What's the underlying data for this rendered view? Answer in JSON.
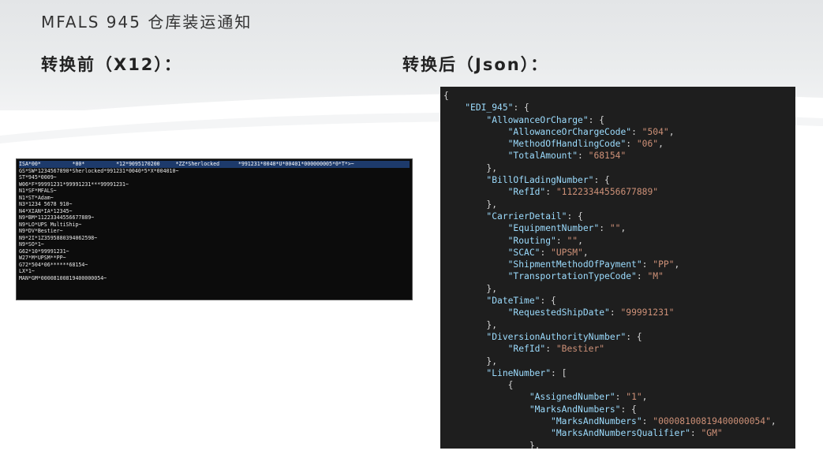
{
  "slide": {
    "title": "MFALS 945 仓库装运通知",
    "before_label": "转换前（X12）：",
    "after_label": "转换后（Json）："
  },
  "colors": {
    "x12_bg": "#0c0c0c",
    "x12_text": "#e8e8e8",
    "x12_highlight": "#1d3a6b",
    "json_bg": "#1e1e1e",
    "json_key": "#9cdcfe",
    "json_string": "#ce9178",
    "json_punct": "#d4d4d4"
  },
  "x12_lines": [
    "ISA*00*          *00*          *12*9095170200     *ZZ*Sherlocked      *991231*0040*U*00401*000000005*0*T*>~",
    "GS*SW*1234567890*Sherlocked*991231*0040*5*X*004010~",
    "ST*945*0009~",
    "W06*F*99991231*99991231***99991231~",
    "N1*SF*MFALS~",
    "N1*ST*Adam~",
    "N3*1234 5678 910~",
    "N4*XIAN*IA*12345~",
    "N9*BM*11223344556677889~",
    "N9*LO*UPS MultiShip~",
    "N9*DV*Bestier~",
    "N9*2I*1Z3595880394062598~",
    "N9*SO*1~",
    "G62*10*99991231~",
    "W27*M*UPSM**PP~",
    "G72*504*06******68154~",
    "LX*1~",
    "MAN*GM*00008100819400000054~"
  ],
  "json_lines": [
    {
      "indent": "",
      "key": "",
      "value": "",
      "tail": "{"
    },
    {
      "indent": "    ",
      "key": "\"EDI_945\"",
      "value": "",
      "tail": ": {"
    },
    {
      "indent": "        ",
      "key": "\"AllowanceOrCharge\"",
      "value": "",
      "tail": ": {"
    },
    {
      "indent": "            ",
      "key": "\"AllowanceOrChargeCode\"",
      "value": "\"504\"",
      "tail": ","
    },
    {
      "indent": "            ",
      "key": "\"MethodOfHandlingCode\"",
      "value": "\"06\"",
      "tail": ","
    },
    {
      "indent": "            ",
      "key": "\"TotalAmount\"",
      "value": "\"68154\"",
      "tail": ""
    },
    {
      "indent": "        ",
      "key": "",
      "value": "",
      "tail": "},"
    },
    {
      "indent": "        ",
      "key": "\"BillOfLadingNumber\"",
      "value": "",
      "tail": ": {"
    },
    {
      "indent": "            ",
      "key": "\"RefId\"",
      "value": "\"11223344556677889\"",
      "tail": ""
    },
    {
      "indent": "        ",
      "key": "",
      "value": "",
      "tail": "},"
    },
    {
      "indent": "        ",
      "key": "\"CarrierDetail\"",
      "value": "",
      "tail": ": {"
    },
    {
      "indent": "            ",
      "key": "\"EquipmentNumber\"",
      "value": "\"\"",
      "tail": ","
    },
    {
      "indent": "            ",
      "key": "\"Routing\"",
      "value": "\"\"",
      "tail": ","
    },
    {
      "indent": "            ",
      "key": "\"SCAC\"",
      "value": "\"UPSM\"",
      "tail": ","
    },
    {
      "indent": "            ",
      "key": "\"ShipmentMethodOfPayment\"",
      "value": "\"PP\"",
      "tail": ","
    },
    {
      "indent": "            ",
      "key": "\"TransportationTypeCode\"",
      "value": "\"M\"",
      "tail": ""
    },
    {
      "indent": "        ",
      "key": "",
      "value": "",
      "tail": "},"
    },
    {
      "indent": "        ",
      "key": "\"DateTime\"",
      "value": "",
      "tail": ": {"
    },
    {
      "indent": "            ",
      "key": "\"RequestedShipDate\"",
      "value": "\"99991231\"",
      "tail": ""
    },
    {
      "indent": "        ",
      "key": "",
      "value": "",
      "tail": "},"
    },
    {
      "indent": "        ",
      "key": "\"DiversionAuthorityNumber\"",
      "value": "",
      "tail": ": {"
    },
    {
      "indent": "            ",
      "key": "\"RefId\"",
      "value": "\"Bestier\"",
      "tail": ""
    },
    {
      "indent": "        ",
      "key": "",
      "value": "",
      "tail": "},"
    },
    {
      "indent": "        ",
      "key": "\"LineNumber\"",
      "value": "",
      "tail": ": ["
    },
    {
      "indent": "            ",
      "key": "",
      "value": "",
      "tail": "{"
    },
    {
      "indent": "                ",
      "key": "\"AssignedNumber\"",
      "value": "\"1\"",
      "tail": ","
    },
    {
      "indent": "                ",
      "key": "\"MarksAndNumbers\"",
      "value": "",
      "tail": ": {"
    },
    {
      "indent": "                    ",
      "key": "\"MarksAndNumbers\"",
      "value": "\"00008100819400000054\"",
      "tail": ","
    },
    {
      "indent": "                    ",
      "key": "\"MarksAndNumbersQualifier\"",
      "value": "\"GM\"",
      "tail": ""
    },
    {
      "indent": "                ",
      "key": "",
      "value": "",
      "tail": "},"
    }
  ]
}
